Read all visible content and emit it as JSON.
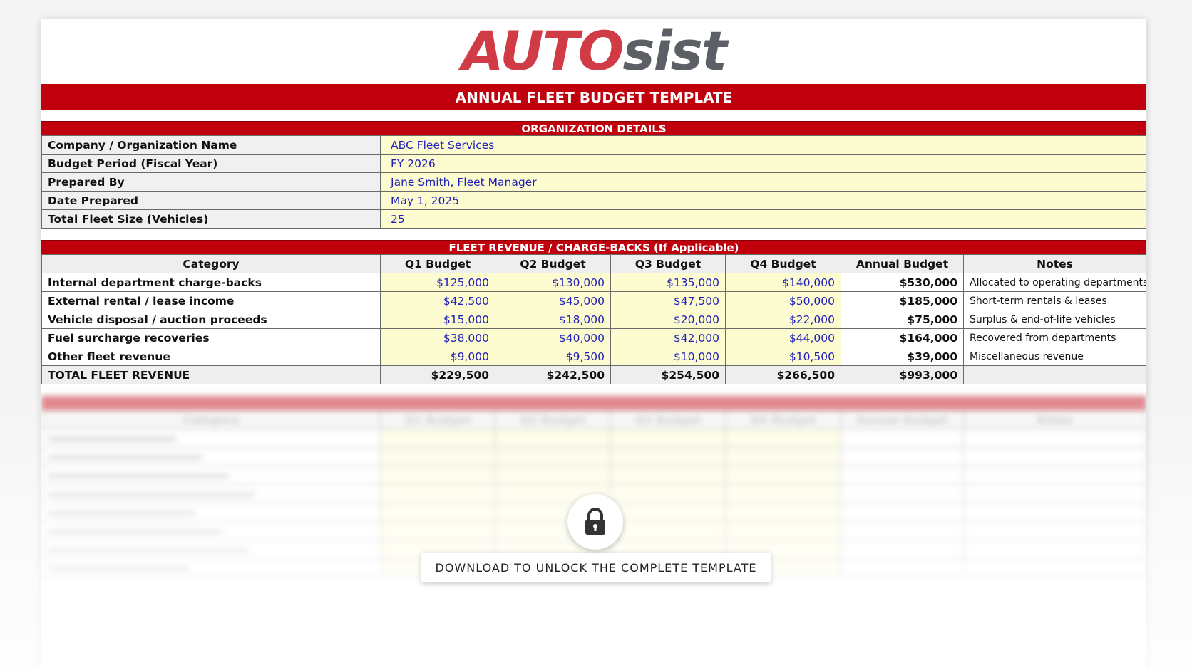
{
  "logo": {
    "part1": "AUTO",
    "part2": "sist"
  },
  "title": "ANNUAL FLEET BUDGET TEMPLATE",
  "org": {
    "heading": "ORGANIZATION DETAILS",
    "rows": [
      {
        "label": "Company / Organization Name",
        "value": "ABC Fleet Services"
      },
      {
        "label": "Budget Period (Fiscal Year)",
        "value": "FY 2026"
      },
      {
        "label": "Prepared By",
        "value": "Jane Smith, Fleet Manager"
      },
      {
        "label": "Date Prepared",
        "value": "May 1, 2025"
      },
      {
        "label": "Total Fleet Size (Vehicles)",
        "value": "25"
      }
    ]
  },
  "revenue": {
    "heading": "FLEET REVENUE / CHARGE-BACKS (If Applicable)",
    "columns": [
      "Category",
      "Q1 Budget",
      "Q2 Budget",
      "Q3 Budget",
      "Q4 Budget",
      "Annual Budget",
      "Notes"
    ],
    "rows": [
      {
        "category": "Internal department charge-backs",
        "q1": "$125,000",
        "q2": "$130,000",
        "q3": "$135,000",
        "q4": "$140,000",
        "annual": "$530,000",
        "notes": "Allocated to operating departments"
      },
      {
        "category": "External rental / lease income",
        "q1": "$42,500",
        "q2": "$45,000",
        "q3": "$47,500",
        "q4": "$50,000",
        "annual": "$185,000",
        "notes": "Short-term rentals & leases"
      },
      {
        "category": "Vehicle disposal / auction proceeds",
        "q1": "$15,000",
        "q2": "$18,000",
        "q3": "$20,000",
        "q4": "$22,000",
        "annual": "$75,000",
        "notes": "Surplus & end-of-life vehicles"
      },
      {
        "category": "Fuel surcharge recoveries",
        "q1": "$38,000",
        "q2": "$40,000",
        "q3": "$42,000",
        "q4": "$44,000",
        "annual": "$164,000",
        "notes": "Recovered from departments"
      },
      {
        "category": "Other fleet revenue",
        "q1": "$9,000",
        "q2": "$9,500",
        "q3": "$10,000",
        "q4": "$10,500",
        "annual": "$39,000",
        "notes": "Miscellaneous revenue"
      }
    ],
    "total": {
      "category": "TOTAL FLEET REVENUE",
      "q1": "$229,500",
      "q2": "$242,500",
      "q3": "$254,500",
      "q4": "$266,500",
      "annual": "$993,000",
      "notes": ""
    }
  },
  "locked": {
    "columns": [
      "Category",
      "Q1 Budget",
      "Q2 Budget",
      "Q3 Budget",
      "Q4 Budget",
      "Annual Budget",
      "Notes"
    ]
  },
  "unlock": {
    "label": "DOWNLOAD TO UNLOCK THE COMPLETE TEMPLATE",
    "icon": "lock-icon"
  },
  "colors": {
    "brand_red": "#c0000d",
    "input_fill": "#fdfbd0",
    "input_text": "#2020b8"
  }
}
